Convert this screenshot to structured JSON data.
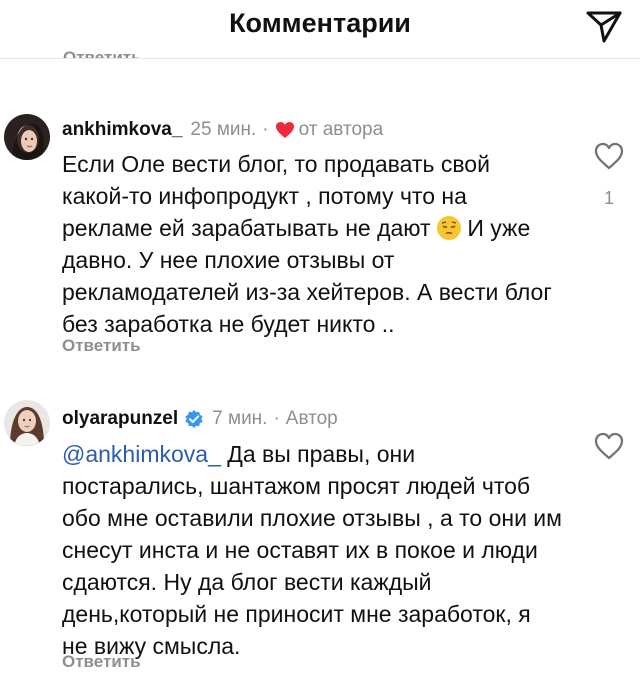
{
  "header": {
    "title": "Комментарии",
    "send_icon": "send-icon",
    "cutoff_reply": "Ответить"
  },
  "comments": [
    {
      "username": "ankhimkova_",
      "time": "25 мин.",
      "tag": "от автора",
      "tag_icon": "heart-icon",
      "tag_icon_color": "#ed2a3d",
      "text_before_emoji": "Если Оле вести блог, то продавать свой какой-то инфопродукт , потому что на рекламе ей зарабатывать не дают ",
      "emoji": "pensive-face-emoji",
      "text_after_emoji": " И уже давно. У нее плохие отзывы от рекламодателей из-за хейтеров. А вести блог без заработка не будет никто ..",
      "reply_label": "Ответить",
      "like_count": "1"
    },
    {
      "username": "olyarapunzel",
      "verified": true,
      "verified_color": "#3797f0",
      "time": "7 мин.",
      "tag": "Автор",
      "mention": "@ankhimkova_",
      "text": " Да вы правы, они постарались, шантажом просят людей чтоб обо мне оставили плохие отзывы , а то они им снесут инста и не оставят их в покое и люди сдаются. Ну да блог вести каждый день,который не приносит мне заработок, я не вижу смысла.",
      "reply_label": "Ответить"
    }
  ]
}
